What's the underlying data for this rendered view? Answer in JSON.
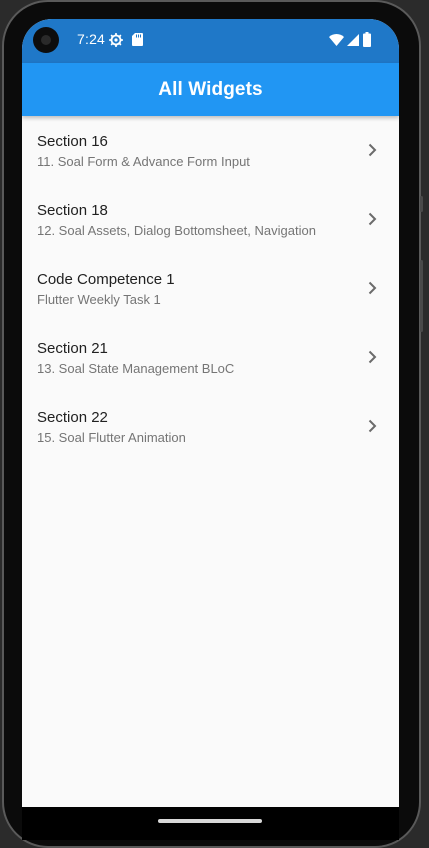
{
  "status_bar": {
    "time": "7:24",
    "icons": [
      "gear-icon",
      "sd-card-icon",
      "wifi-icon",
      "signal-icon",
      "battery-icon"
    ]
  },
  "app_bar": {
    "title": "All Widgets",
    "color": "#2196f3"
  },
  "list": {
    "items": [
      {
        "title": "Section 16",
        "subtitle": "11. Soal Form & Advance Form Input"
      },
      {
        "title": "Section 18",
        "subtitle": "12. Soal Assets, Dialog Bottomsheet, Navigation"
      },
      {
        "title": "Code Competence 1",
        "subtitle": "Flutter Weekly Task 1"
      },
      {
        "title": "Section 21",
        "subtitle": "13. Soal State Management BLoC"
      },
      {
        "title": "Section 22",
        "subtitle": "15. Soal Flutter Animation"
      }
    ]
  }
}
